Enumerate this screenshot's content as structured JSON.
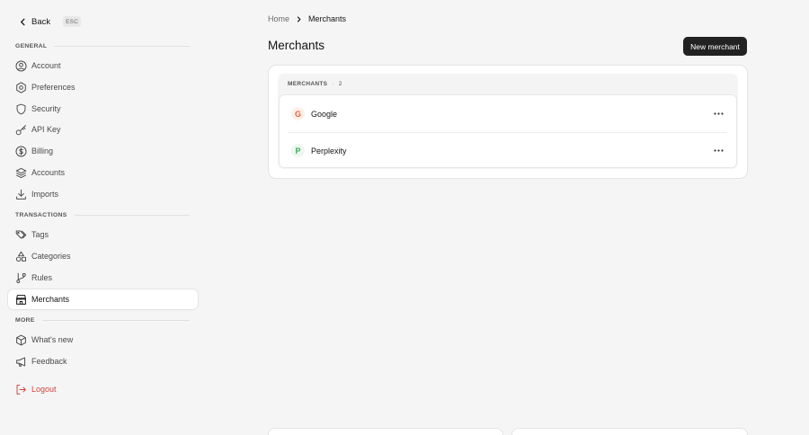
{
  "sidebar": {
    "back_label": "Back",
    "esc_label": "ESC",
    "sections": {
      "general": "GENERAL",
      "transactions": "TRANSACTIONS",
      "more": "MORE"
    },
    "items": {
      "account": {
        "label": "Account",
        "icon": "user-circle-icon"
      },
      "preferences": {
        "label": "Preferences",
        "icon": "gear-icon"
      },
      "security": {
        "label": "Security",
        "icon": "shield-icon"
      },
      "api_key": {
        "label": "API Key",
        "icon": "key-icon"
      },
      "billing": {
        "label": "Billing",
        "icon": "dollar-circle-icon"
      },
      "accounts": {
        "label": "Accounts",
        "icon": "layers-icon"
      },
      "imports": {
        "label": "Imports",
        "icon": "download-icon"
      },
      "tags": {
        "label": "Tags",
        "icon": "tags-icon"
      },
      "categories": {
        "label": "Categories",
        "icon": "shapes-icon"
      },
      "rules": {
        "label": "Rules",
        "icon": "git-branch-icon"
      },
      "merchants": {
        "label": "Merchants",
        "icon": "store-icon",
        "active": true
      },
      "whats_new": {
        "label": "What's new",
        "icon": "package-icon"
      },
      "feedback": {
        "label": "Feedback",
        "icon": "megaphone-icon"
      },
      "logout": {
        "label": "Logout",
        "icon": "logout-icon"
      }
    }
  },
  "breadcrumb": {
    "home": "Home",
    "current": "Merchants"
  },
  "main": {
    "title": "Merchants",
    "new_button": "New merchant",
    "list_header": "MERCHANTS",
    "list_separator": "·",
    "list_count": "2",
    "merchants": [
      {
        "name": "Google",
        "initial": "G",
        "color": "#e8643a",
        "bg": "#fdf0ea"
      },
      {
        "name": "Perplexity",
        "initial": "P",
        "color": "#3fa85c",
        "bg": "#edf7ef"
      }
    ]
  },
  "colors": {
    "background": "#f5f5f5",
    "primary_button": "#222222",
    "logout": "#d2453d"
  }
}
